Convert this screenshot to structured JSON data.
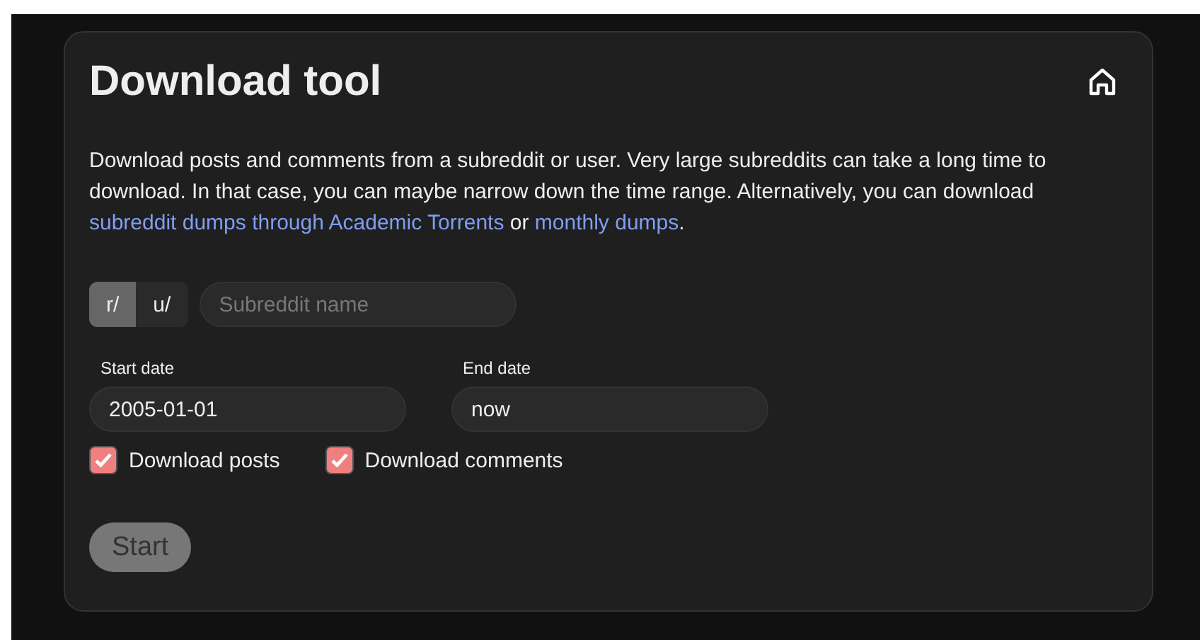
{
  "title": "Download tool",
  "description": [
    {
      "kind": "text",
      "text": "Download posts and comments from a subreddit or user. Very large subreddits can take a long time to download. In that case, you can maybe narrow down the time range. Alternatively, you can download "
    },
    {
      "kind": "link",
      "text": "subreddit dumps through Academic Torrents"
    },
    {
      "kind": "text",
      "text": " or "
    },
    {
      "kind": "link",
      "text": "monthly dumps"
    },
    {
      "kind": "text",
      "text": "."
    }
  ],
  "prefixes": [
    {
      "label": "r/",
      "selected": true
    },
    {
      "label": "u/",
      "selected": false
    }
  ],
  "name_field": {
    "placeholder": "Subreddit name"
  },
  "dates": [
    {
      "label": "Start date",
      "value": "2005-01-01"
    },
    {
      "label": "End date",
      "value": "now"
    }
  ],
  "checkboxes": [
    {
      "label": "Download posts",
      "checked": true
    },
    {
      "label": "Download comments",
      "checked": true
    }
  ],
  "start_button": {
    "label": "Start",
    "disabled": true
  }
}
